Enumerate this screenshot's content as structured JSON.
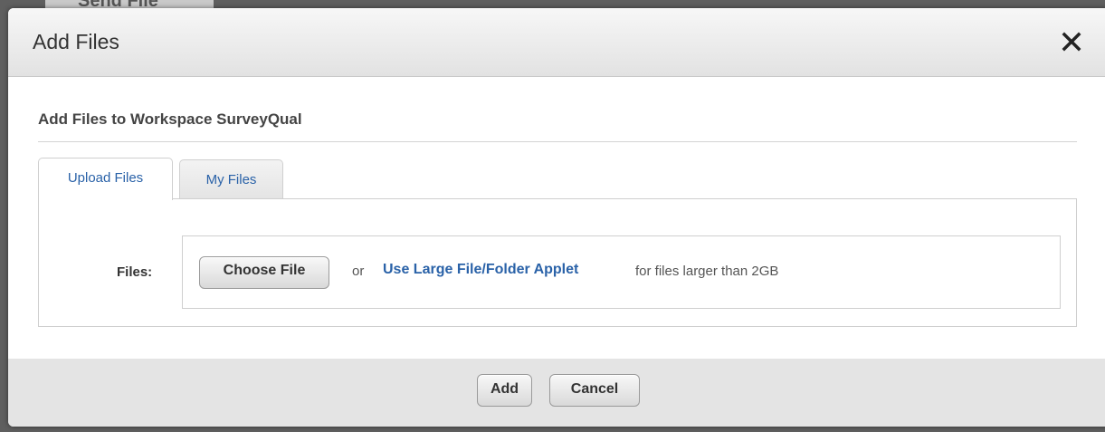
{
  "background": {
    "partial_label": "Send File"
  },
  "dialog": {
    "title": "Add Files",
    "close_icon": "close-icon"
  },
  "section": {
    "heading": "Add Files to Workspace SurveyQual"
  },
  "tabs": [
    {
      "label": "Upload Files",
      "active": true
    },
    {
      "label": "My Files",
      "active": false
    }
  ],
  "upload": {
    "files_label": "Files:",
    "choose_file_label": "Choose File",
    "or_text": "or",
    "applet_link": "Use Large File/Folder Applet",
    "applet_suffix": "for files larger than 2GB"
  },
  "footer": {
    "add_label": "Add",
    "cancel_label": "Cancel"
  },
  "colors": {
    "link": "#2a62a8",
    "footer_bg": "#e4e4e4"
  }
}
